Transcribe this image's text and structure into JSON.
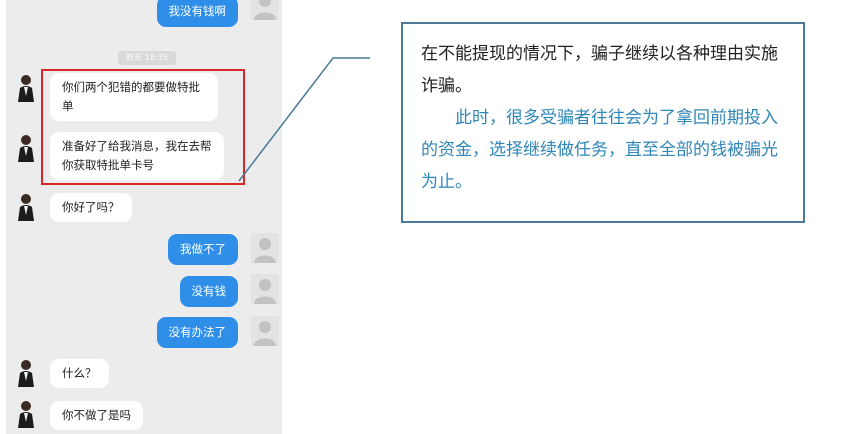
{
  "chat": {
    "time_label": "昨天 18:35",
    "messages": [
      {
        "side": "right",
        "text": "我没有钱啊"
      },
      {
        "side": "left",
        "text": "你们两个犯错的都要做特批单"
      },
      {
        "side": "left",
        "text": "准备好了给我消息，我在去帮你获取特批单卡号"
      },
      {
        "side": "left",
        "text": "你好了吗？"
      },
      {
        "side": "right",
        "text": "我做不了"
      },
      {
        "side": "right",
        "text": "没有钱"
      },
      {
        "side": "right",
        "text": "没有办法了"
      },
      {
        "side": "left",
        "text": "什么？"
      },
      {
        "side": "left",
        "text": "你不做了是吗"
      }
    ]
  },
  "note": {
    "black_text": "在不能提现的情况下，骗子继续以各种理由实施诈骗。",
    "blue_text": "此时，很多受骗者往往会为了拿回前期投入的资金，选择继续做任务，直至全部的钱被骗光为止。"
  },
  "colors": {
    "highlight_box": "#d9262b",
    "note_border": "#4a7a97",
    "note_blue": "#2f86b8",
    "bubble_blue": "#2f8fe8"
  }
}
